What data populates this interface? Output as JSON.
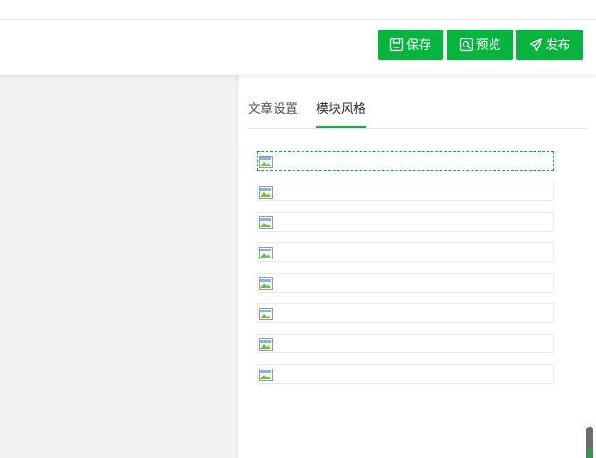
{
  "toolbar": {
    "save_label": "保存",
    "preview_label": "预览",
    "publish_label": "发布",
    "accent_color": "#07b43e"
  },
  "settings_panel": {
    "tabs": [
      {
        "label": "文章设置",
        "active": false
      },
      {
        "label": "模块风格",
        "active": true
      }
    ],
    "style_modules": [
      {
        "selected": true,
        "icon": "broken-image-icon"
      },
      {
        "selected": false,
        "icon": "broken-image-icon"
      },
      {
        "selected": false,
        "icon": "broken-image-icon"
      },
      {
        "selected": false,
        "icon": "broken-image-icon"
      },
      {
        "selected": false,
        "icon": "broken-image-icon"
      },
      {
        "selected": false,
        "icon": "broken-image-icon"
      },
      {
        "selected": false,
        "icon": "broken-image-icon"
      },
      {
        "selected": false,
        "icon": "broken-image-icon"
      }
    ]
  }
}
